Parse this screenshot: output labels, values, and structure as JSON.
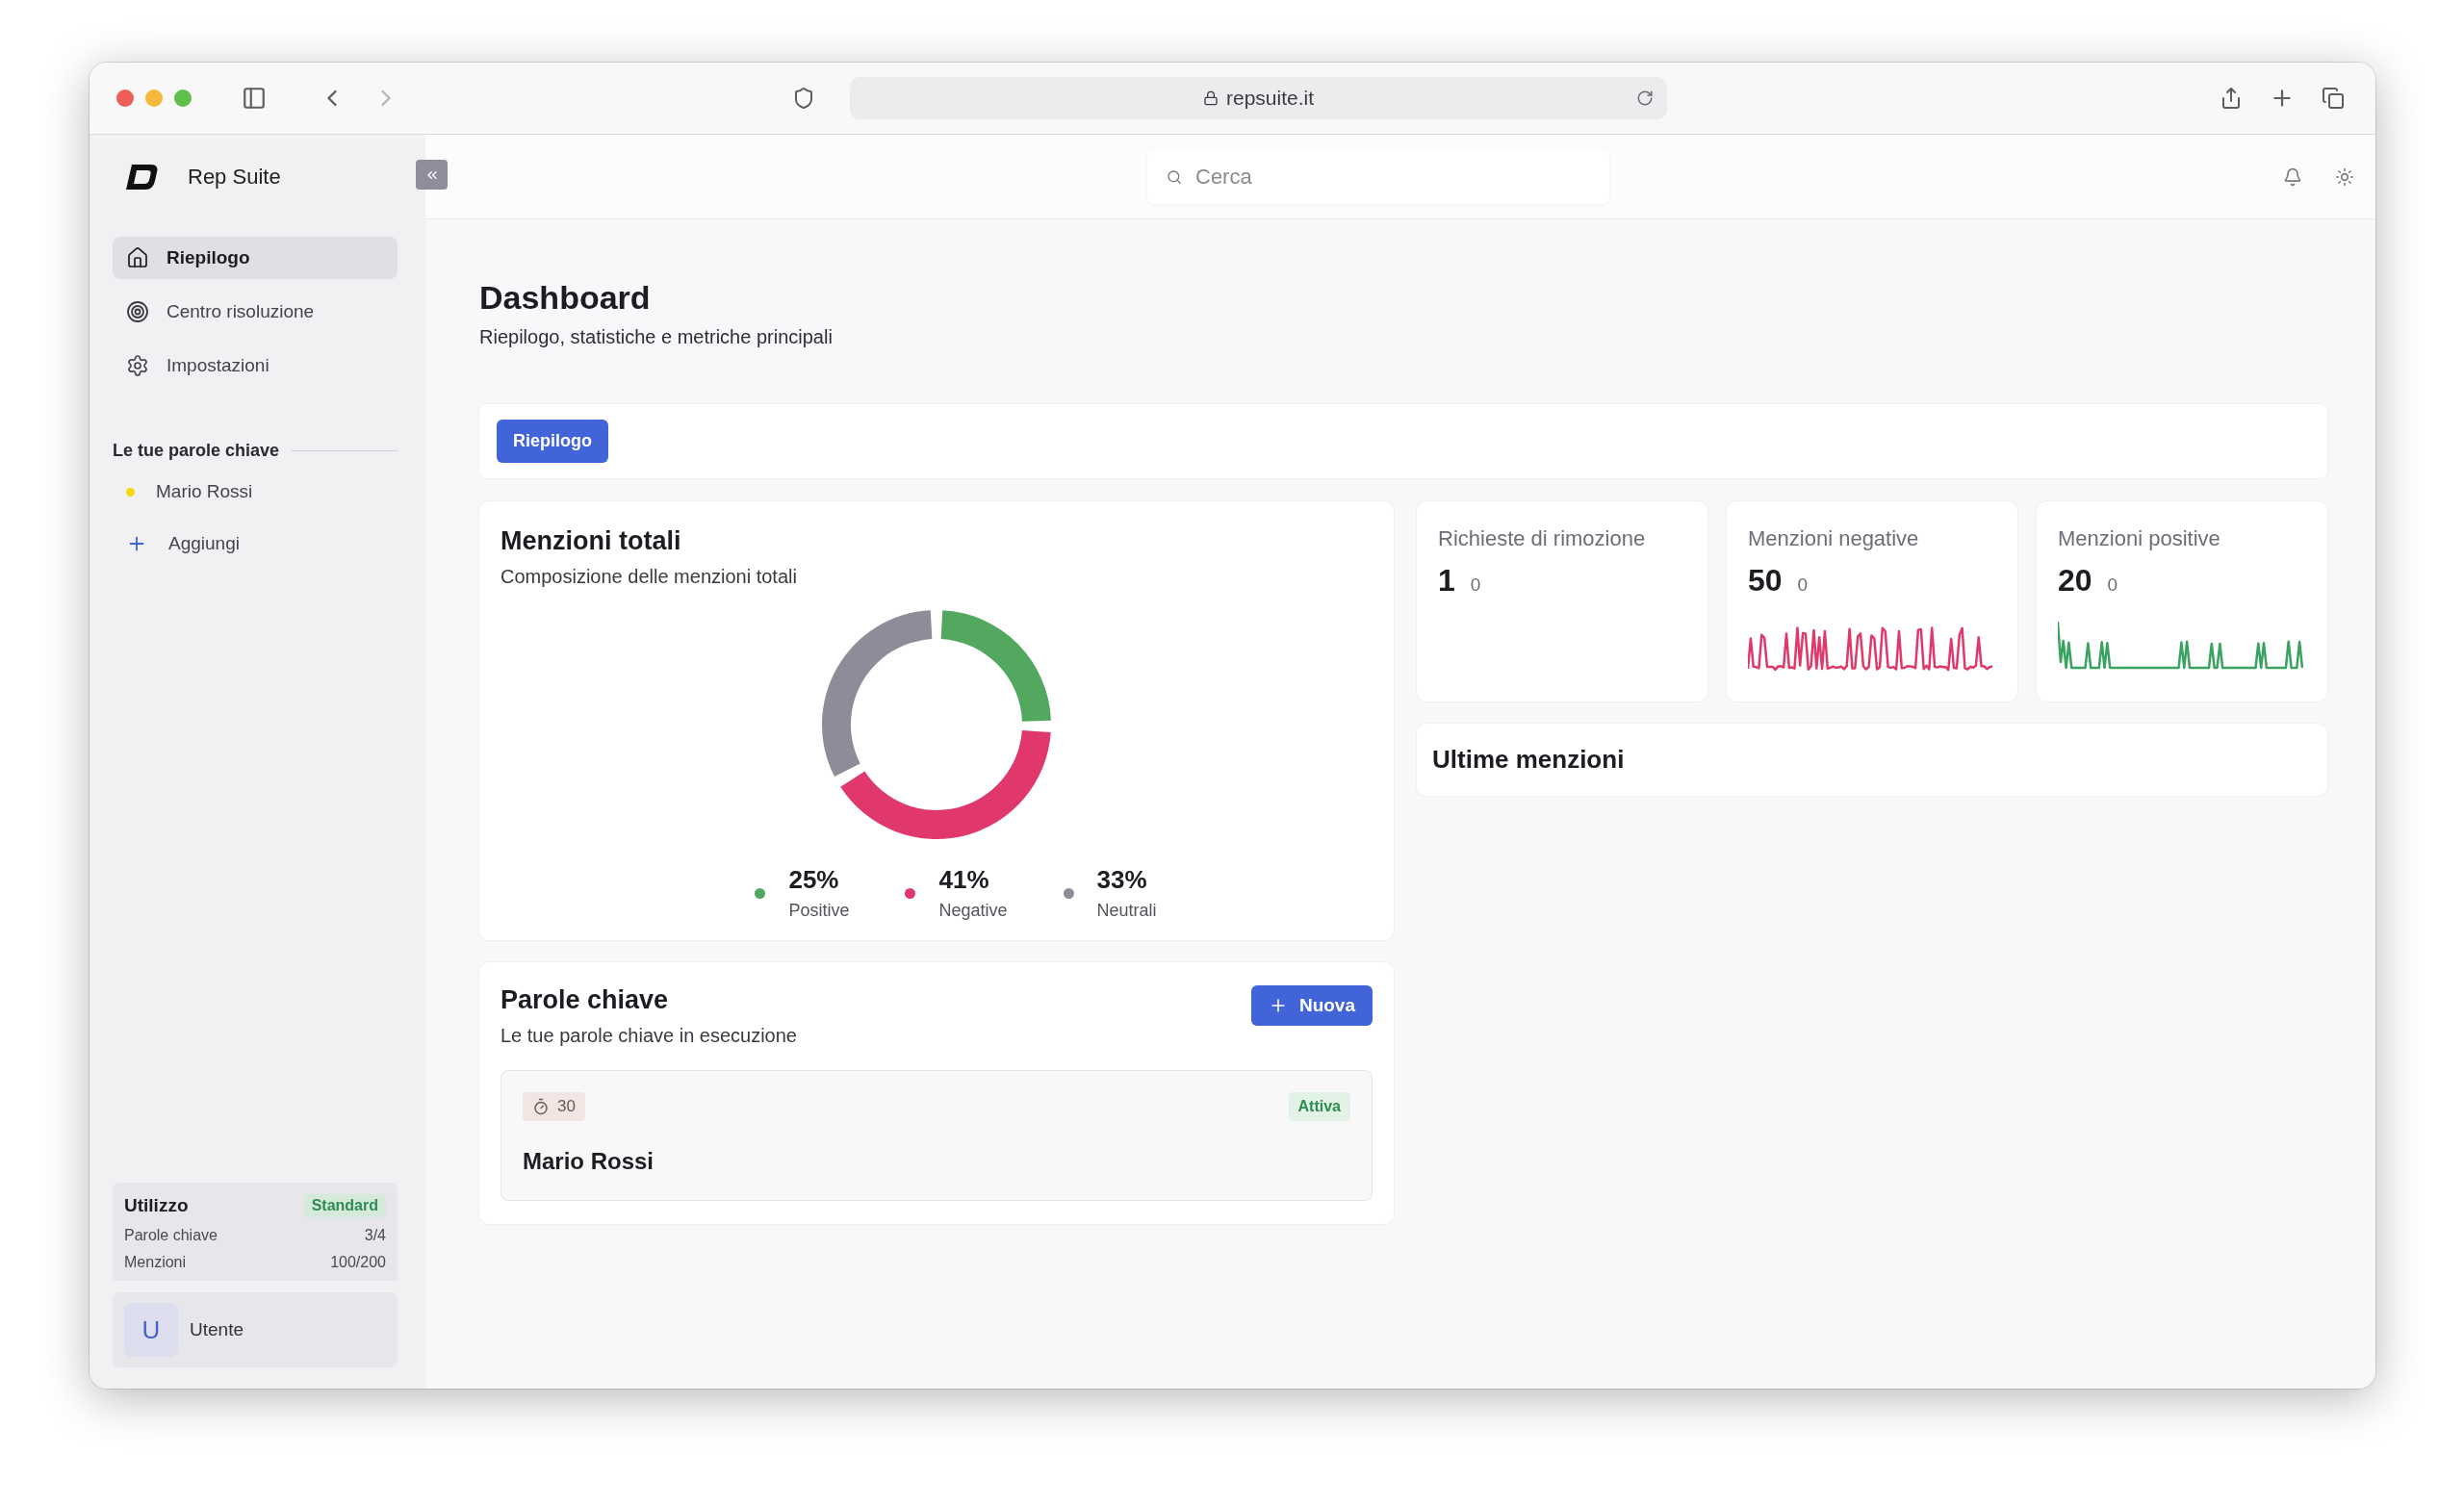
{
  "browser": {
    "url": "repsuite.it"
  },
  "sidebar": {
    "brand": "Rep Suite",
    "nav": [
      {
        "label": "Riepilogo",
        "selected": true
      },
      {
        "label": "Centro risoluzione",
        "selected": false
      },
      {
        "label": "Impostazioni",
        "selected": false
      }
    ],
    "keywords_title": "Le tue parole chiave",
    "keywords": [
      {
        "label": "Mario Rossi",
        "color": "#f5d90a"
      }
    ],
    "add_label": "Aggiungi",
    "usage": {
      "title": "Utilizzo",
      "plan": "Standard",
      "rows": [
        {
          "label": "Parole chiave",
          "value": "3/4"
        },
        {
          "label": "Menzioni",
          "value": "100/200"
        }
      ]
    },
    "user": {
      "initial": "U",
      "name": "Utente"
    }
  },
  "topbar": {
    "search": {
      "placeholder": "Cerca"
    }
  },
  "page": {
    "title": "Dashboard",
    "subtitle": "Riepilogo, statistiche e metriche principali"
  },
  "tabs": [
    {
      "label": "Riepilogo",
      "selected": true
    }
  ],
  "total_mentions": {
    "title": "Menzioni totali",
    "subtitle": "Composizione delle menzioni totali",
    "chart_data": {
      "type": "donut",
      "categories": [
        "Positive",
        "Negative",
        "Neutrali"
      ],
      "values": [
        25,
        41,
        33
      ]
    },
    "legend": [
      {
        "value": "25%",
        "color": "#52a85e"
      },
      {
        "value": "41%",
        "color": "#e0386a"
      },
      {
        "value": "33%",
        "color": "#8e8c99"
      }
    ]
  },
  "stats": [
    {
      "kind": "count",
      "label": "Richieste di rimozione",
      "value": "1",
      "change": "0"
    },
    {
      "kind": "trend",
      "label": "Menzioni negative",
      "value": "50",
      "change": "0",
      "color": "#e0386a"
    },
    {
      "kind": "trend",
      "label": "Menzioni positive",
      "value": "20",
      "change": "0",
      "color": "#3aa35f"
    }
  ],
  "latest": {
    "title": "Ultime menzioni"
  },
  "keywords_panel": {
    "title": "Parole chiave",
    "subtitle": "Le tue parole chiave in esecuzione",
    "new_button": "Nuova",
    "items": [
      {
        "interval": "30",
        "status": "Attiva",
        "name": "Mario Rossi"
      }
    ]
  }
}
